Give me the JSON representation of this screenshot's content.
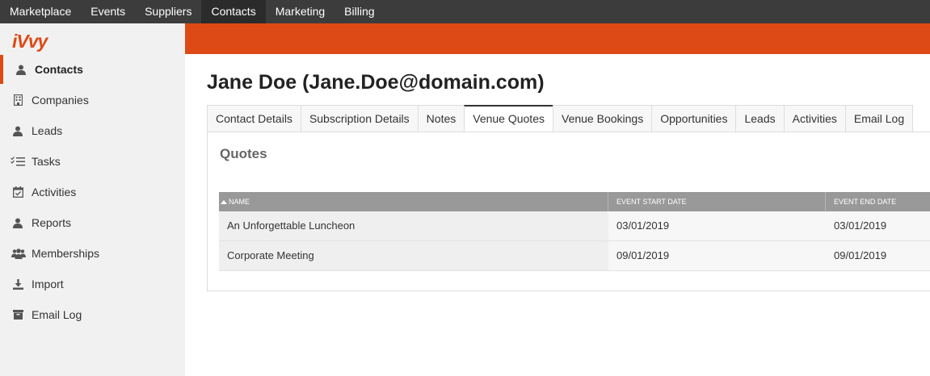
{
  "topnav": {
    "items": [
      {
        "label": "Marketplace",
        "active": false
      },
      {
        "label": "Events",
        "active": false
      },
      {
        "label": "Suppliers",
        "active": false
      },
      {
        "label": "Contacts",
        "active": true
      },
      {
        "label": "Marketing",
        "active": false
      },
      {
        "label": "Billing",
        "active": false
      }
    ]
  },
  "brand": {
    "logo_text": "iVvy",
    "accent_color": "#dd4a15"
  },
  "sidebar": {
    "items": [
      {
        "label": "Contacts",
        "icon": "user-icon",
        "active": true
      },
      {
        "label": "Companies",
        "icon": "building-icon",
        "active": false
      },
      {
        "label": "Leads",
        "icon": "user-icon",
        "active": false
      },
      {
        "label": "Tasks",
        "icon": "checklist-icon",
        "active": false
      },
      {
        "label": "Activities",
        "icon": "calendar-check-icon",
        "active": false
      },
      {
        "label": "Reports",
        "icon": "user-icon",
        "active": false
      },
      {
        "label": "Memberships",
        "icon": "users-icon",
        "active": false
      },
      {
        "label": "Import",
        "icon": "download-icon",
        "active": false
      },
      {
        "label": "Email Log",
        "icon": "archive-icon",
        "active": false
      }
    ]
  },
  "main": {
    "title": "Jane Doe (Jane.Doe@domain.com)",
    "tabs": [
      {
        "label": "Contact Details",
        "active": false
      },
      {
        "label": "Subscription Details",
        "active": false
      },
      {
        "label": "Notes",
        "active": false
      },
      {
        "label": "Venue Quotes",
        "active": true
      },
      {
        "label": "Venue Bookings",
        "active": false
      },
      {
        "label": "Opportunities",
        "active": false
      },
      {
        "label": "Leads",
        "active": false
      },
      {
        "label": "Activities",
        "active": false
      },
      {
        "label": "Email Log",
        "active": false
      }
    ],
    "section_title": "Quotes",
    "table": {
      "columns": [
        "NAME",
        "EVENT START DATE",
        "EVENT END DATE"
      ],
      "rows": [
        [
          "An Unforgettable Luncheon",
          "03/01/2019",
          "03/01/2019"
        ],
        [
          "Corporate Meeting",
          "09/01/2019",
          "09/01/2019"
        ]
      ]
    }
  }
}
